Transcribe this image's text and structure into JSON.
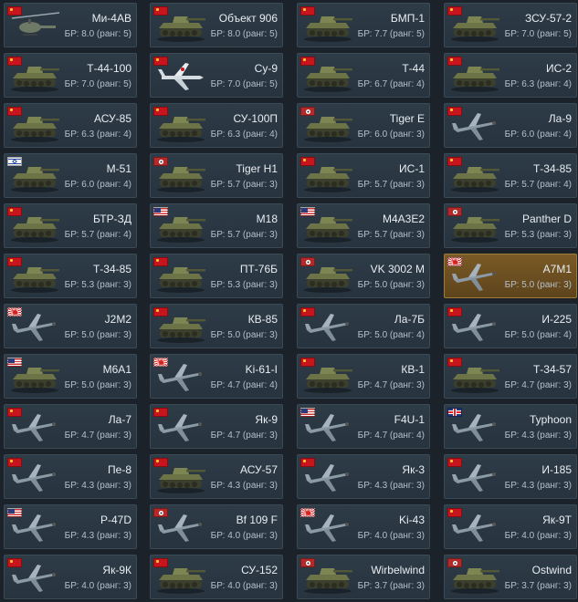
{
  "colors": {
    "background": "#1c2229",
    "card": "#2e3c48",
    "card_premium": "#7a5a26",
    "name_text": "#e8edf1",
    "br_text": "#b5c0c9"
  },
  "vehicles": [
    {
      "name": "Ми-4АВ",
      "br": "БР: 8.0 (ранг: 5)",
      "nation": "ussr",
      "kind": "heli"
    },
    {
      "name": "Объект 906",
      "br": "БР: 8.0 (ранг: 5)",
      "nation": "ussr",
      "kind": "tank"
    },
    {
      "name": "БМП-1",
      "br": "БР: 7.7 (ранг: 5)",
      "nation": "ussr",
      "kind": "tank"
    },
    {
      "name": "ЗСУ-57-2",
      "br": "БР: 7.0 (ранг: 5)",
      "nation": "ussr",
      "kind": "tank"
    },
    {
      "name": "Т-44-100",
      "br": "БР: 7.0 (ранг: 5)",
      "nation": "ussr",
      "kind": "tank"
    },
    {
      "name": "Су-9",
      "br": "БР: 7.0 (ранг: 5)",
      "nation": "ussr",
      "kind": "jet"
    },
    {
      "name": "Т-44",
      "br": "БР: 6.7 (ранг: 4)",
      "nation": "ussr",
      "kind": "tank"
    },
    {
      "name": "ИС-2",
      "br": "БР: 6.3 (ранг: 4)",
      "nation": "ussr",
      "kind": "tank"
    },
    {
      "name": "АСУ-85",
      "br": "БР: 6.3 (ранг: 4)",
      "nation": "ussr",
      "kind": "tank"
    },
    {
      "name": "СУ-100П",
      "br": "БР: 6.3 (ранг: 4)",
      "nation": "ussr",
      "kind": "tank"
    },
    {
      "name": "Tiger E",
      "br": "БР: 6.0 (ранг: 3)",
      "nation": "germany",
      "kind": "tank"
    },
    {
      "name": "Ла-9",
      "br": "БР: 6.0 (ранг: 4)",
      "nation": "ussr",
      "kind": "plane"
    },
    {
      "name": "M-51",
      "br": "БР: 6.0 (ранг: 4)",
      "nation": "israel",
      "kind": "tank"
    },
    {
      "name": "Tiger H1",
      "br": "БР: 5.7 (ранг: 3)",
      "nation": "germany",
      "kind": "tank"
    },
    {
      "name": "ИС-1",
      "br": "БР: 5.7 (ранг: 3)",
      "nation": "ussr",
      "kind": "tank"
    },
    {
      "name": "Т-34-85",
      "br": "БР: 5.7 (ранг: 4)",
      "nation": "ussr",
      "kind": "tank"
    },
    {
      "name": "БТР-ЗД",
      "br": "БР: 5.7 (ранг: 4)",
      "nation": "ussr",
      "kind": "tank"
    },
    {
      "name": "M18",
      "br": "БР: 5.7 (ранг: 3)",
      "nation": "usa",
      "kind": "tank"
    },
    {
      "name": "M4A3E2",
      "br": "БР: 5.7 (ранг: 3)",
      "nation": "usa",
      "kind": "tank"
    },
    {
      "name": "Panther D",
      "br": "БР: 5.3 (ранг: 3)",
      "nation": "germany",
      "kind": "tank"
    },
    {
      "name": "Т-34-85",
      "br": "БР: 5.3 (ранг: 3)",
      "nation": "ussr",
      "kind": "tank"
    },
    {
      "name": "ПТ-76Б",
      "br": "БР: 5.3 (ранг: 3)",
      "nation": "ussr",
      "kind": "tank"
    },
    {
      "name": "VK 3002 M",
      "br": "БР: 5.0 (ранг: 3)",
      "nation": "germany",
      "kind": "tank"
    },
    {
      "name": "A7M1",
      "br": "БР: 5.0 (ранг: 3)",
      "nation": "japan",
      "kind": "plane",
      "premium": true
    },
    {
      "name": "J2M2",
      "br": "БР: 5.0 (ранг: 3)",
      "nation": "japan",
      "kind": "plane"
    },
    {
      "name": "КВ-85",
      "br": "БР: 5.0 (ранг: 3)",
      "nation": "ussr",
      "kind": "tank"
    },
    {
      "name": "Ла-7Б",
      "br": "БР: 5.0 (ранг: 4)",
      "nation": "ussr",
      "kind": "plane"
    },
    {
      "name": "И-225",
      "br": "БР: 5.0 (ранг: 4)",
      "nation": "ussr",
      "kind": "plane"
    },
    {
      "name": "M6A1",
      "br": "БР: 5.0 (ранг: 3)",
      "nation": "usa",
      "kind": "tank"
    },
    {
      "name": "Ki-61-I",
      "br": "БР: 4.7 (ранг: 4)",
      "nation": "japan",
      "kind": "plane"
    },
    {
      "name": "КВ-1",
      "br": "БР: 4.7 (ранг: 3)",
      "nation": "ussr",
      "kind": "tank"
    },
    {
      "name": "Т-34-57",
      "br": "БР: 4.7 (ранг: 3)",
      "nation": "ussr",
      "kind": "tank"
    },
    {
      "name": "Ла-7",
      "br": "БР: 4.7 (ранг: 3)",
      "nation": "ussr",
      "kind": "plane"
    },
    {
      "name": "Як-9",
      "br": "БР: 4.7 (ранг: 3)",
      "nation": "ussr",
      "kind": "plane"
    },
    {
      "name": "F4U-1",
      "br": "БР: 4.7 (ранг: 4)",
      "nation": "usa",
      "kind": "plane"
    },
    {
      "name": "Typhoon",
      "br": "БР: 4.3 (ранг: 3)",
      "nation": "britain",
      "kind": "plane"
    },
    {
      "name": "Пе-8",
      "br": "БР: 4.3 (ранг: 3)",
      "nation": "ussr",
      "kind": "plane"
    },
    {
      "name": "АСУ-57",
      "br": "БР: 4.3 (ранг: 3)",
      "nation": "ussr",
      "kind": "tank"
    },
    {
      "name": "Як-3",
      "br": "БР: 4.3 (ранг: 3)",
      "nation": "ussr",
      "kind": "plane"
    },
    {
      "name": "И-185",
      "br": "БР: 4.3 (ранг: 3)",
      "nation": "ussr",
      "kind": "plane"
    },
    {
      "name": "P-47D",
      "br": "БР: 4.3 (ранг: 3)",
      "nation": "usa",
      "kind": "plane"
    },
    {
      "name": "Bf 109 F",
      "br": "БР: 4.0 (ранг: 3)",
      "nation": "germany",
      "kind": "plane"
    },
    {
      "name": "Ki-43",
      "br": "БР: 4.0 (ранг: 3)",
      "nation": "japan",
      "kind": "plane"
    },
    {
      "name": "Як-9Т",
      "br": "БР: 4.0 (ранг: 3)",
      "nation": "ussr",
      "kind": "plane"
    },
    {
      "name": "Як-9К",
      "br": "БР: 4.0 (ранг: 3)",
      "nation": "ussr",
      "kind": "plane"
    },
    {
      "name": "СУ-152",
      "br": "БР: 4.0 (ранг: 3)",
      "nation": "ussr",
      "kind": "tank"
    },
    {
      "name": "Wirbelwind",
      "br": "БР: 3.7 (ранг: 3)",
      "nation": "germany",
      "kind": "tank"
    },
    {
      "name": "Ostwind",
      "br": "БР: 3.7 (ранг: 3)",
      "nation": "germany",
      "kind": "tank"
    }
  ]
}
